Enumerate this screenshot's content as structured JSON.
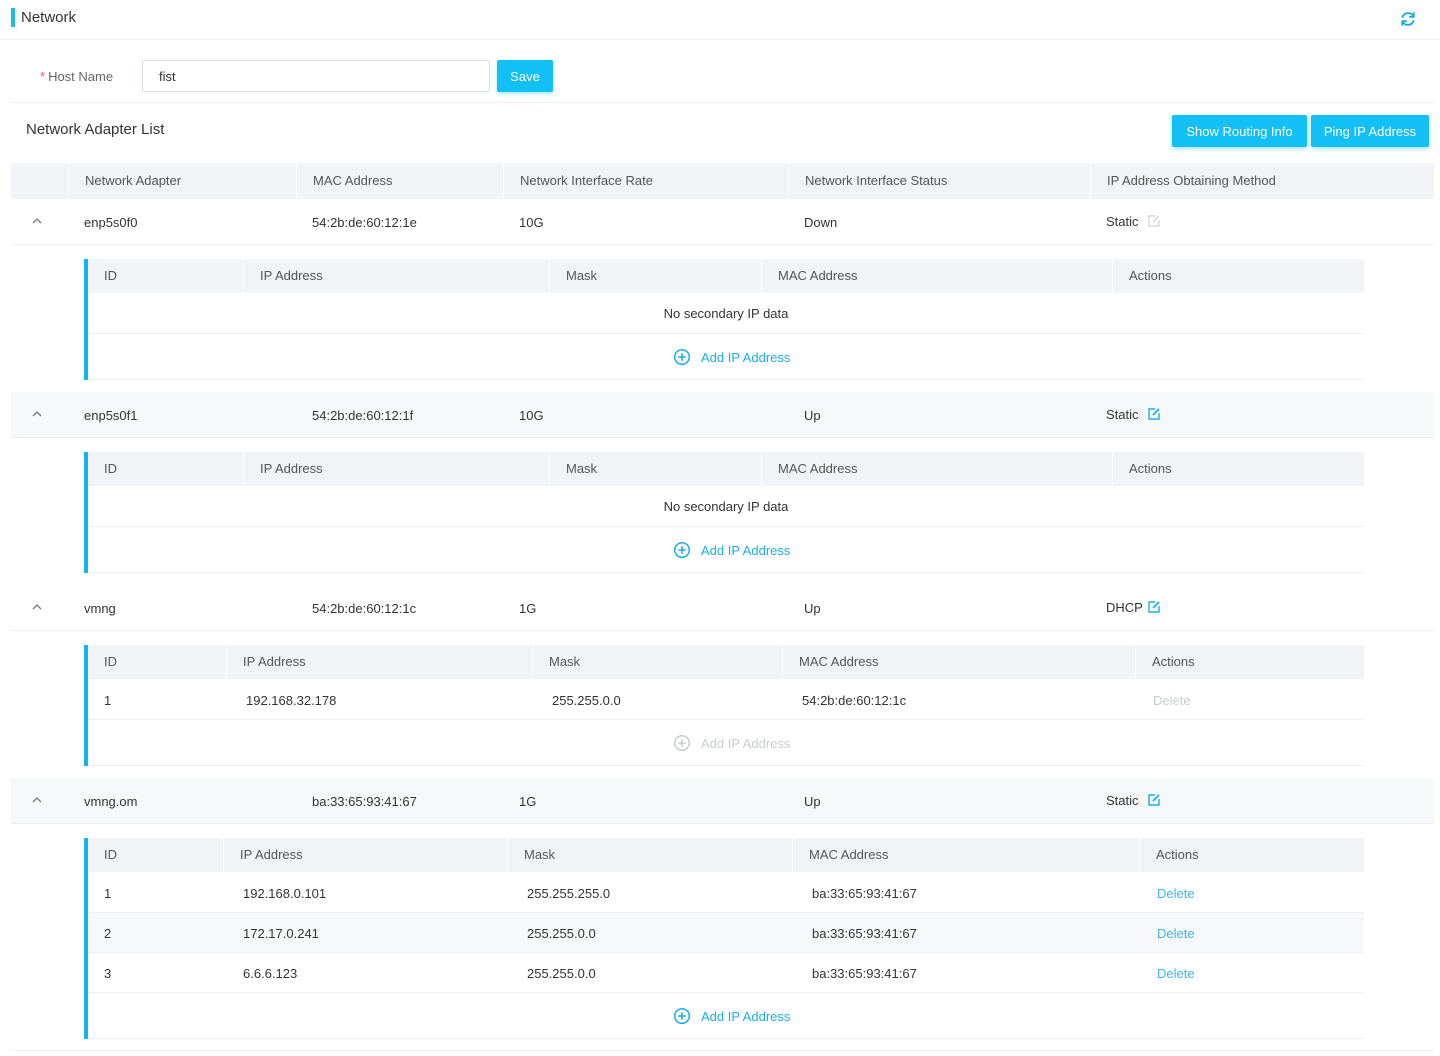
{
  "header": {
    "title": "Network",
    "refresh_icon": "refresh-icon"
  },
  "host": {
    "label": "Host Name",
    "required_mark": "*",
    "value": "fist",
    "save_label": "Save"
  },
  "list": {
    "title": "Network Adapter List",
    "routing_btn": "Show Routing Info",
    "ping_btn": "Ping IP Address",
    "columns": [
      "Network Adapter",
      "MAC Address",
      "Network Interface Rate",
      "Network Interface Status",
      "IP Address Obtaining Method"
    ]
  },
  "sub_columns": [
    "ID",
    "IP Address",
    "Mask",
    "MAC Address",
    "Actions"
  ],
  "no_data": "No secondary IP data",
  "add_label": "Add IP Address",
  "delete_label": "Delete",
  "adapters": [
    {
      "name": "enp5s0f0",
      "mac": "54:2b:de:60:12:1e",
      "rate": "10G",
      "status": "Down",
      "method": "Static",
      "rows": []
    },
    {
      "name": "enp5s0f1",
      "mac": "54:2b:de:60:12:1f",
      "rate": "10G",
      "status": "Up",
      "method": "Static",
      "rows": []
    },
    {
      "name": "vmng",
      "mac": "54:2b:de:60:12:1c",
      "rate": "1G",
      "status": "Up",
      "method": "DHCP",
      "rows": [
        {
          "id": "1",
          "ip": "192.168.32.178",
          "mask": "255.255.0.0",
          "mac": "54:2b:de:60:12:1c"
        }
      ]
    },
    {
      "name": "vmng.om",
      "mac": "ba:33:65:93:41:67",
      "rate": "1G",
      "status": "Up",
      "method": "Static",
      "rows": [
        {
          "id": "1",
          "ip": "192.168.0.101",
          "mask": "255.255.255.0",
          "mac": "ba:33:65:93:41:67"
        },
        {
          "id": "2",
          "ip": "172.17.0.241",
          "mask": "255.255.0.0",
          "mac": "ba:33:65:93:41:67"
        },
        {
          "id": "3",
          "ip": "6.6.6.123",
          "mask": "255.255.0.0",
          "mac": "ba:33:65:93:41:67"
        }
      ]
    }
  ],
  "colors": {
    "accent": "#12c0f5",
    "link": "#1aaee8",
    "disabled": "#c8ccd2"
  }
}
